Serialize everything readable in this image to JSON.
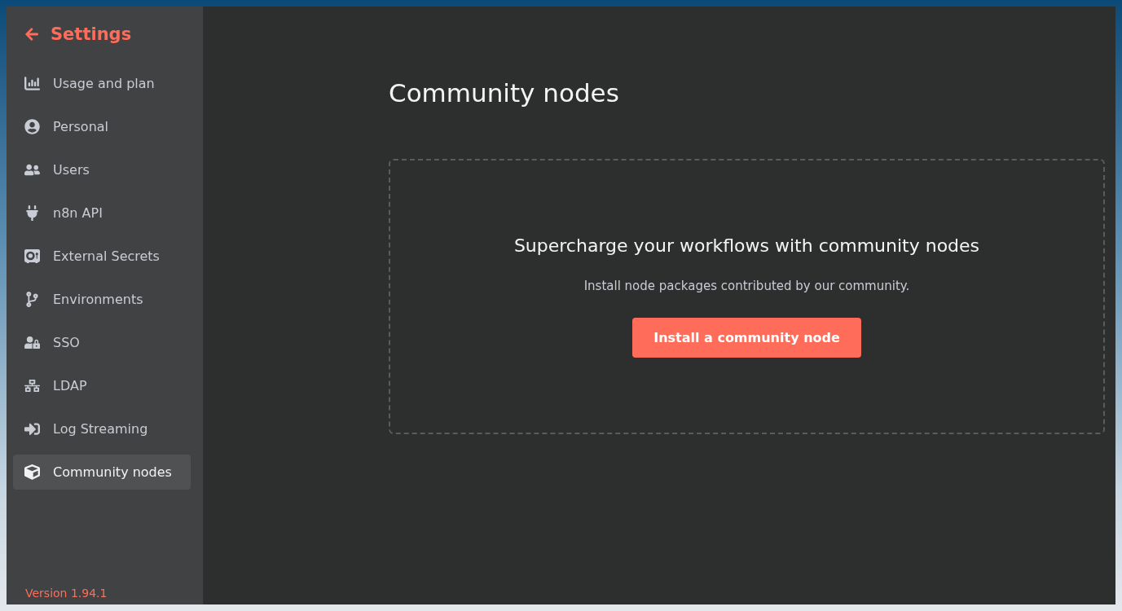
{
  "sidebar": {
    "back_title": "Settings",
    "items": [
      {
        "label": "Usage and plan",
        "selected": false
      },
      {
        "label": "Personal",
        "selected": false
      },
      {
        "label": "Users",
        "selected": false
      },
      {
        "label": "n8n API",
        "selected": false
      },
      {
        "label": "External Secrets",
        "selected": false
      },
      {
        "label": "Environments",
        "selected": false
      },
      {
        "label": "SSO",
        "selected": false
      },
      {
        "label": "LDAP",
        "selected": false
      },
      {
        "label": "Log Streaming",
        "selected": false
      },
      {
        "label": "Community nodes",
        "selected": true
      }
    ],
    "version": "Version 1.94.1"
  },
  "main": {
    "title": "Community nodes",
    "empty_state": {
      "heading": "Supercharge your workflows with community nodes",
      "description": "Install node packages contributed by our community.",
      "button": "Install a community node"
    }
  }
}
